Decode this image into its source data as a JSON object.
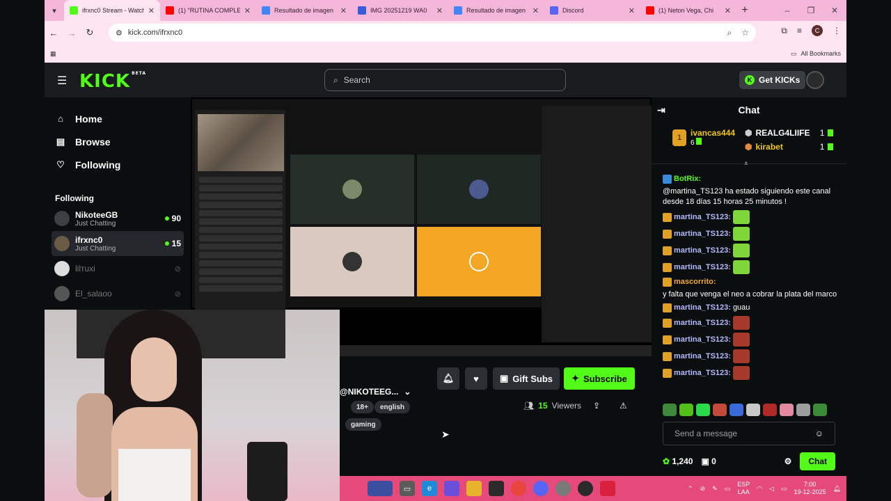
{
  "browser": {
    "tabs": [
      {
        "title": "ifrxnc0 Stream - Watch",
        "color": "#53fc18",
        "active": true
      },
      {
        "title": "(1) \"RUTINA COMPLETA",
        "color": "#ff0000"
      },
      {
        "title": "Resultado de imagen",
        "color": "#4285f4"
      },
      {
        "title": "IMG 20251219 WA0",
        "color": "#3b5bdb"
      },
      {
        "title": "Resultado de imagen",
        "color": "#4285f4"
      },
      {
        "title": "Discord",
        "color": "#5865f2"
      },
      {
        "title": "(1) Neton Vega, Chi",
        "color": "#ff0000"
      }
    ],
    "url": "kick.com/ifrxnc0",
    "all_bookmarks": "All Bookmarks",
    "avatar_letter": "C"
  },
  "kick": {
    "logo": "KICK",
    "logo_beta": "BETA",
    "search_placeholder": "Search",
    "get_kicks": "Get KICKs",
    "nav": {
      "home": "Home",
      "browse": "Browse",
      "following": "Following"
    },
    "following_title": "Following",
    "following": [
      {
        "name": "NikoteeGB",
        "category": "Just Chatting",
        "viewers": "90"
      },
      {
        "name": "ifrxnc0",
        "category": "Just Chatting",
        "viewers": "15"
      },
      {
        "name": "lilтuxi"
      },
      {
        "name": "El_salaoo"
      }
    ],
    "video_viewer_count": "15",
    "actions": {
      "gift_subs": "Gift Subs",
      "subscribe": "Subscribe"
    },
    "channel_name": "@NIKOTEEG...",
    "tags": [
      "18+",
      "english",
      "gaming"
    ],
    "viewers_count": "15",
    "viewers_label": "Viewers"
  },
  "chat": {
    "title": "Chat",
    "leaderboard": {
      "first": {
        "rank": "1",
        "name": "ivancas444",
        "value": "6"
      },
      "others": [
        {
          "name": "REALG4LIIFE",
          "value": "1"
        },
        {
          "name": "kirabet",
          "value": "1"
        }
      ]
    },
    "messages": [
      {
        "user": "BotRix:",
        "text": "@martina_TS123 ha estado siguiendo este canal desde 18 días 15 horas 25 minutos !",
        "color": "#53fc18"
      },
      {
        "user": "martina_TS123:",
        "emote": true,
        "color": "#b7b9ff"
      },
      {
        "user": "martina_TS123:",
        "emote": true,
        "color": "#b7b9ff"
      },
      {
        "user": "martina_TS123:",
        "emote": true,
        "color": "#b7b9ff"
      },
      {
        "user": "martina_TS123:",
        "emote": true,
        "color": "#b7b9ff"
      },
      {
        "user": "mascorrito:",
        "text": "y falta que venga el neo a cobrar la plata del marco",
        "color": "#f2a83b"
      },
      {
        "user": "martina_TS123:",
        "text": "guau",
        "color": "#b7b9ff"
      },
      {
        "user": "martina_TS123:",
        "emote2": true,
        "color": "#b7b9ff"
      },
      {
        "user": "martina_TS123:",
        "emote2": true,
        "color": "#b7b9ff"
      },
      {
        "user": "martina_TS123:",
        "emote2": true,
        "color": "#b7b9ff"
      },
      {
        "user": "martina_TS123:",
        "emote2": true,
        "color": "#b7b9ff"
      }
    ],
    "input_placeholder": "Send a message",
    "points": "1,240",
    "gifts": "0",
    "chat_button": "Chat"
  },
  "taskbar": {
    "lang": "ESP",
    "lang2": "LAA",
    "time": "7:00",
    "date": "19-12-2025"
  }
}
